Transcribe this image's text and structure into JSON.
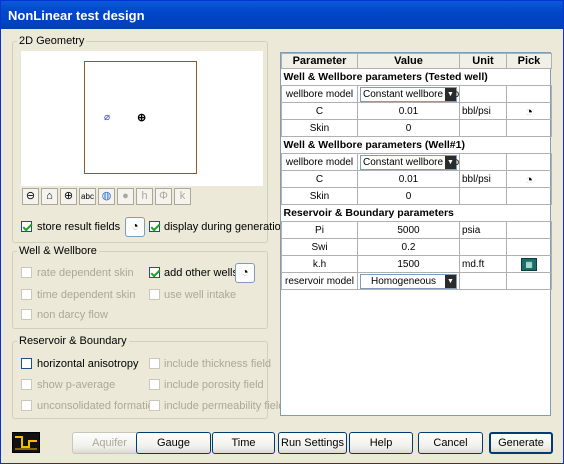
{
  "window": {
    "title": "NonLinear test design"
  },
  "geometry": {
    "legend": "2D Geometry",
    "toolbar": [
      "⊖",
      "⌂",
      "⊕",
      "abc",
      "◍",
      "●",
      "h",
      "Φ",
      "k"
    ],
    "store_result_fields": "store result fields",
    "display_during_generation": "display during generation"
  },
  "well": {
    "legend": "Well & Wellbore",
    "rate_dependent_skin": "rate dependent skin",
    "add_other_wells": "add other wells",
    "time_dependent_skin": "time dependent skin",
    "use_well_intake": "use well intake",
    "non_darcy_flow": "non darcy flow"
  },
  "reservoir": {
    "legend": "Reservoir & Boundary",
    "horizontal_anisotropy": "horizontal anisotropy",
    "include_thickness_field": "include thickness field",
    "show_p_average": "show p-average",
    "include_porosity_field": "include porosity field",
    "unconsolidated_formation": "unconsolidated formation",
    "include_permeability_field": "include permeability field"
  },
  "table": {
    "headers": [
      "Parameter",
      "Value",
      "Unit",
      "Pick"
    ],
    "sec1": "Well & Wellbore parameters (Tested well)",
    "r1": {
      "param": "wellbore model",
      "value": "Constant wellbore sto"
    },
    "r2": {
      "param": "C",
      "value": "0.01",
      "unit": "bbl/psi"
    },
    "r3": {
      "param": "Skin",
      "value": "0"
    },
    "sec2": "Well & Wellbore parameters (Well#1)",
    "r4": {
      "param": "wellbore model",
      "value": "Constant wellbore sto"
    },
    "r5": {
      "param": "C",
      "value": "0.01",
      "unit": "bbl/psi"
    },
    "r6": {
      "param": "Skin",
      "value": "0"
    },
    "sec3": "Reservoir & Boundary parameters",
    "r7": {
      "param": "Pi",
      "value": "5000",
      "unit": "psia"
    },
    "r8": {
      "param": "Swi",
      "value": "0.2"
    },
    "r9": {
      "param": "k.h",
      "value": "1500",
      "unit": "md.ft"
    },
    "r10": {
      "param": "reservoir model",
      "value": "Homogeneous"
    }
  },
  "buttons": {
    "aquifer": "Aquifer",
    "gauge": "Gauge",
    "time": "Time",
    "run_settings": "Run Settings",
    "help": "Help",
    "cancel": "Cancel",
    "generate": "Generate"
  }
}
